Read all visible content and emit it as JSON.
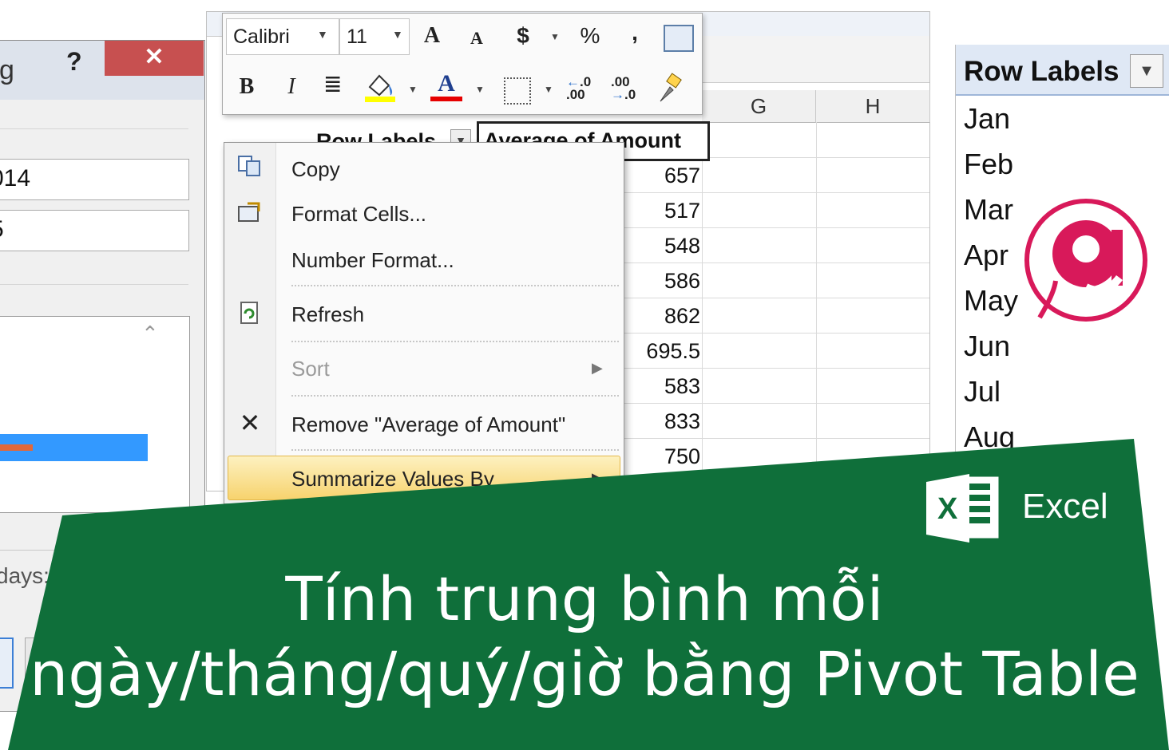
{
  "dialog": {
    "title_fragment": "g",
    "help_label": "?",
    "close_label": "✕",
    "start_value": "014",
    "end_value": "5",
    "footer_text": "days:"
  },
  "toolbar": {
    "font_name": "Calibri",
    "font_size": "11",
    "grow_font": "A",
    "shrink_font": "A",
    "currency": "$",
    "percent": "%",
    "comma": ",",
    "bold": "B",
    "italic": "I",
    "font_color": "A",
    "inc_decimal": ".00",
    "dec_decimal": ".0"
  },
  "sheet": {
    "columns": [
      "G",
      "H"
    ],
    "pivot_row_labels": "Row Labels",
    "pivot_value_header": "Average of Amount",
    "values": [
      "657",
      "517",
      "548",
      "586",
      "862",
      "695.5",
      "583",
      "833",
      "750"
    ]
  },
  "context_menu": {
    "items": [
      {
        "label": "Copy",
        "icon": "copy-icon",
        "enabled": true
      },
      {
        "label": "Format Cells...",
        "icon": "format-cells-icon",
        "enabled": true
      },
      {
        "label": "Number Format...",
        "icon": "",
        "enabled": true
      },
      {
        "label": "Refresh",
        "icon": "refresh-icon",
        "enabled": true
      },
      {
        "label": "Sort",
        "icon": "",
        "enabled": false
      },
      {
        "label": "Remove \"Average of Amount\"",
        "icon": "close-icon",
        "enabled": true
      },
      {
        "label": "Summarize Values By",
        "icon": "",
        "enabled": true
      }
    ]
  },
  "right_panel": {
    "title": "Row Labels",
    "months": [
      "Jan",
      "Feb",
      "Mar",
      "Apr",
      "May",
      "Jun",
      "Jul",
      "Aug"
    ]
  },
  "banner": {
    "line1": "Tính trung bình mỗi",
    "line2": "ngày/tháng/quý/giờ bằng Pivot Table",
    "app_label": "Excel",
    "colors": {
      "banner_green": "#0f6f3a",
      "logo_pink": "#d8195a"
    }
  }
}
